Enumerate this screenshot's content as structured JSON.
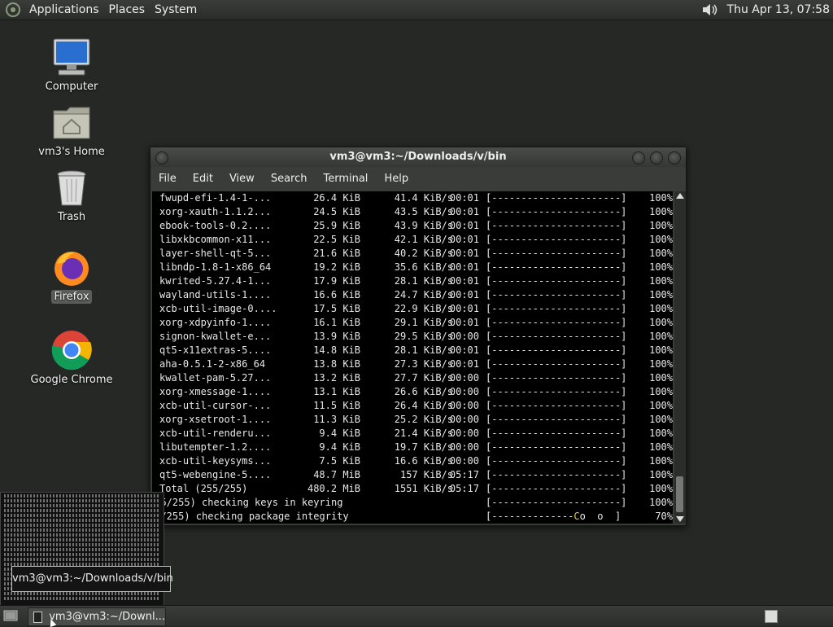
{
  "top_panel": {
    "menus": [
      "Applications",
      "Places",
      "System"
    ],
    "clock": "Thu Apr 13, 07:58"
  },
  "desktop_icons": [
    {
      "label": "Computer",
      "icon": "computer-icon"
    },
    {
      "label": "vm3's Home",
      "icon": "home-folder-icon"
    },
    {
      "label": "Trash",
      "icon": "trash-icon"
    },
    {
      "label": "Firefox",
      "icon": "firefox-icon"
    },
    {
      "label": "Google Chrome",
      "icon": "chrome-icon"
    }
  ],
  "terminal": {
    "title": "vm3@vm3:~/Downloads/v/bin",
    "menu": [
      "File",
      "Edit",
      "View",
      "Search",
      "Terminal",
      "Help"
    ],
    "rows": [
      {
        "name": "fwupd-efi-1.4-1-...",
        "size": "26.4 KiB",
        "rate": "41.4 KiB/s",
        "time": "00:01",
        "bar": "[----------------------]",
        "pct": "100%"
      },
      {
        "name": "xorg-xauth-1.1.2...",
        "size": "24.5 KiB",
        "rate": "43.5 KiB/s",
        "time": "00:01",
        "bar": "[----------------------]",
        "pct": "100%"
      },
      {
        "name": "ebook-tools-0.2....",
        "size": "25.9 KiB",
        "rate": "43.9 KiB/s",
        "time": "00:01",
        "bar": "[----------------------]",
        "pct": "100%"
      },
      {
        "name": "libxkbcommon-x11...",
        "size": "22.5 KiB",
        "rate": "42.1 KiB/s",
        "time": "00:01",
        "bar": "[----------------------]",
        "pct": "100%"
      },
      {
        "name": "layer-shell-qt-5...",
        "size": "21.6 KiB",
        "rate": "40.2 KiB/s",
        "time": "00:01",
        "bar": "[----------------------]",
        "pct": "100%"
      },
      {
        "name": "libndp-1.8-1-x86_64",
        "size": "19.2 KiB",
        "rate": "35.6 KiB/s",
        "time": "00:01",
        "bar": "[----------------------]",
        "pct": "100%"
      },
      {
        "name": "kwrited-5.27.4-1...",
        "size": "17.9 KiB",
        "rate": "28.1 KiB/s",
        "time": "00:01",
        "bar": "[----------------------]",
        "pct": "100%"
      },
      {
        "name": "wayland-utils-1....",
        "size": "16.6 KiB",
        "rate": "24.7 KiB/s",
        "time": "00:01",
        "bar": "[----------------------]",
        "pct": "100%"
      },
      {
        "name": "xcb-util-image-0....",
        "size": "17.5 KiB",
        "rate": "22.9 KiB/s",
        "time": "00:01",
        "bar": "[----------------------]",
        "pct": "100%"
      },
      {
        "name": "xorg-xdpyinfo-1....",
        "size": "16.1 KiB",
        "rate": "29.1 KiB/s",
        "time": "00:01",
        "bar": "[----------------------]",
        "pct": "100%"
      },
      {
        "name": "signon-kwallet-e...",
        "size": "13.9 KiB",
        "rate": "29.5 KiB/s",
        "time": "00:00",
        "bar": "[----------------------]",
        "pct": "100%"
      },
      {
        "name": "qt5-x11extras-5....",
        "size": "14.8 KiB",
        "rate": "28.1 KiB/s",
        "time": "00:01",
        "bar": "[----------------------]",
        "pct": "100%"
      },
      {
        "name": "aha-0.5.1-2-x86_64",
        "size": "13.8 KiB",
        "rate": "27.3 KiB/s",
        "time": "00:01",
        "bar": "[----------------------]",
        "pct": "100%"
      },
      {
        "name": "kwallet-pam-5.27...",
        "size": "13.2 KiB",
        "rate": "27.7 KiB/s",
        "time": "00:00",
        "bar": "[----------------------]",
        "pct": "100%"
      },
      {
        "name": "xorg-xmessage-1....",
        "size": "13.1 KiB",
        "rate": "26.6 KiB/s",
        "time": "00:00",
        "bar": "[----------------------]",
        "pct": "100%"
      },
      {
        "name": "xcb-util-cursor-...",
        "size": "11.5 KiB",
        "rate": "26.4 KiB/s",
        "time": "00:00",
        "bar": "[----------------------]",
        "pct": "100%"
      },
      {
        "name": "xorg-xsetroot-1....",
        "size": "11.3 KiB",
        "rate": "25.2 KiB/s",
        "time": "00:00",
        "bar": "[----------------------]",
        "pct": "100%"
      },
      {
        "name": "xcb-util-renderu...",
        "size": "9.4 KiB",
        "rate": "21.4 KiB/s",
        "time": "00:00",
        "bar": "[----------------------]",
        "pct": "100%"
      },
      {
        "name": "libutempter-1.2....",
        "size": "9.4 KiB",
        "rate": "19.7 KiB/s",
        "time": "00:00",
        "bar": "[----------------------]",
        "pct": "100%"
      },
      {
        "name": "xcb-util-keysyms...",
        "size": "7.5 KiB",
        "rate": "16.6 KiB/s",
        "time": "00:00",
        "bar": "[----------------------]",
        "pct": "100%"
      },
      {
        "name": "qt5-webengine-5....",
        "size": "48.7 MiB",
        "rate": "157 KiB/s",
        "time": "05:17",
        "bar": "[----------------------]",
        "pct": "100%"
      },
      {
        "name": "Total (255/255)",
        "size": "480.2 MiB",
        "rate": "1551 KiB/s",
        "time": "05:17",
        "bar": "[----------------------]",
        "pct": "100%"
      }
    ],
    "checks": [
      {
        "text": "255/255) checking keys in keyring",
        "bar": "[----------------------]",
        "pct": "100%"
      },
      {
        "text": "97/255) checking package integrity",
        "bar_done": "[--------------",
        "bar_pac": "C",
        "bar_rest": "o  o  ]",
        "pct": "70%"
      }
    ]
  },
  "preview_tooltip": "vm3@vm3:~/Downloads/v/bin",
  "taskbar": {
    "window_label": "vm3@vm3:~/Downl..."
  },
  "colors": {
    "desktop_bg": "#262826",
    "terminal_bg": "#000000",
    "pacman_color": "#f0c53b"
  }
}
